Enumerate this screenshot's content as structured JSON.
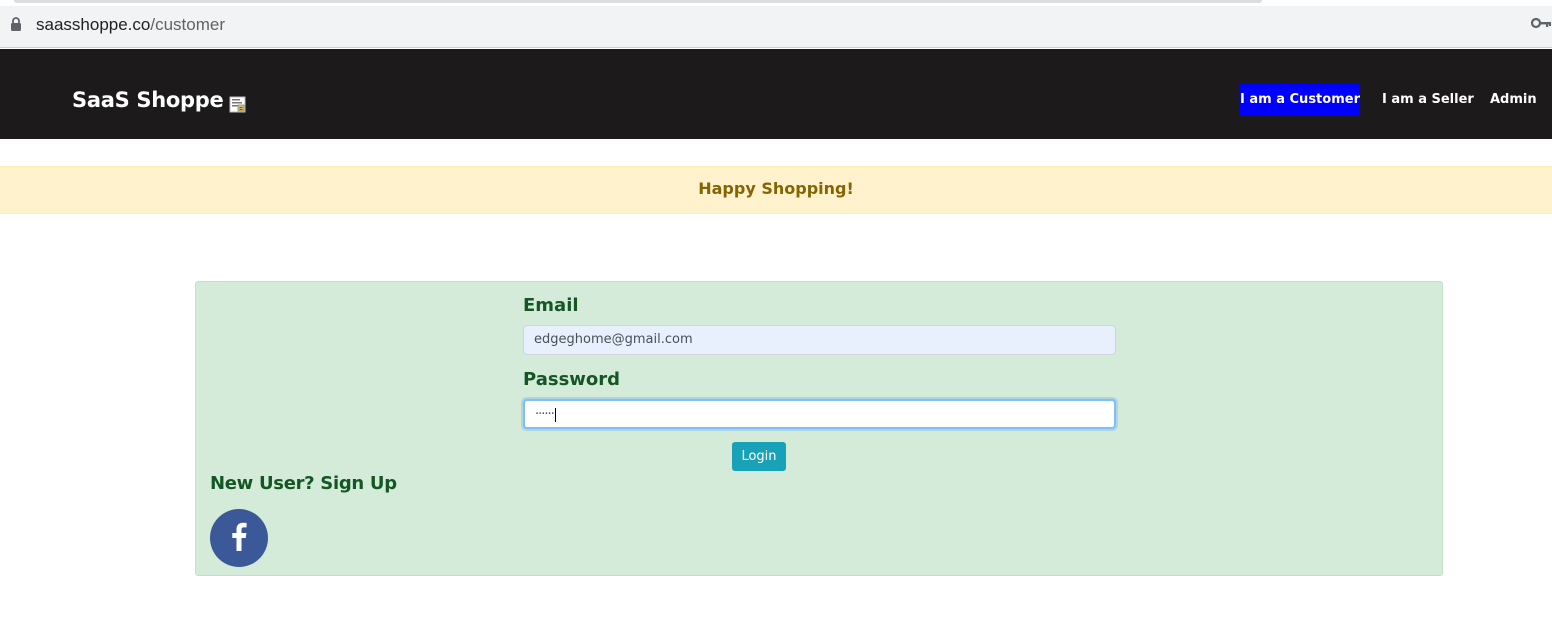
{
  "browser": {
    "url_host": "saasshoppe.co",
    "url_path": "/customer",
    "icons": [
      "lock-icon",
      "key-icon"
    ]
  },
  "navbar": {
    "brand": "SaaS Shoppe",
    "brand_icon": "document-icon",
    "links": [
      {
        "label": "I am a Customer",
        "active": true
      },
      {
        "label": "I am a Seller",
        "active": false
      },
      {
        "label": "Admin",
        "active": false
      }
    ],
    "background_color": "#1c1a1b",
    "active_color": "#0000ff"
  },
  "alert": {
    "message": "Happy Shopping!",
    "background_color": "#fff2cc",
    "text_color": "#856404"
  },
  "login": {
    "email_label": "Email",
    "email_value": "edgeghome@gmail.com",
    "password_label": "Password",
    "password_value": "······",
    "login_button": "Login",
    "signup_text": "New User? Sign Up",
    "social_icon": "facebook-icon",
    "card_color": "#d4ebda",
    "button_color": "#17a2b8"
  }
}
